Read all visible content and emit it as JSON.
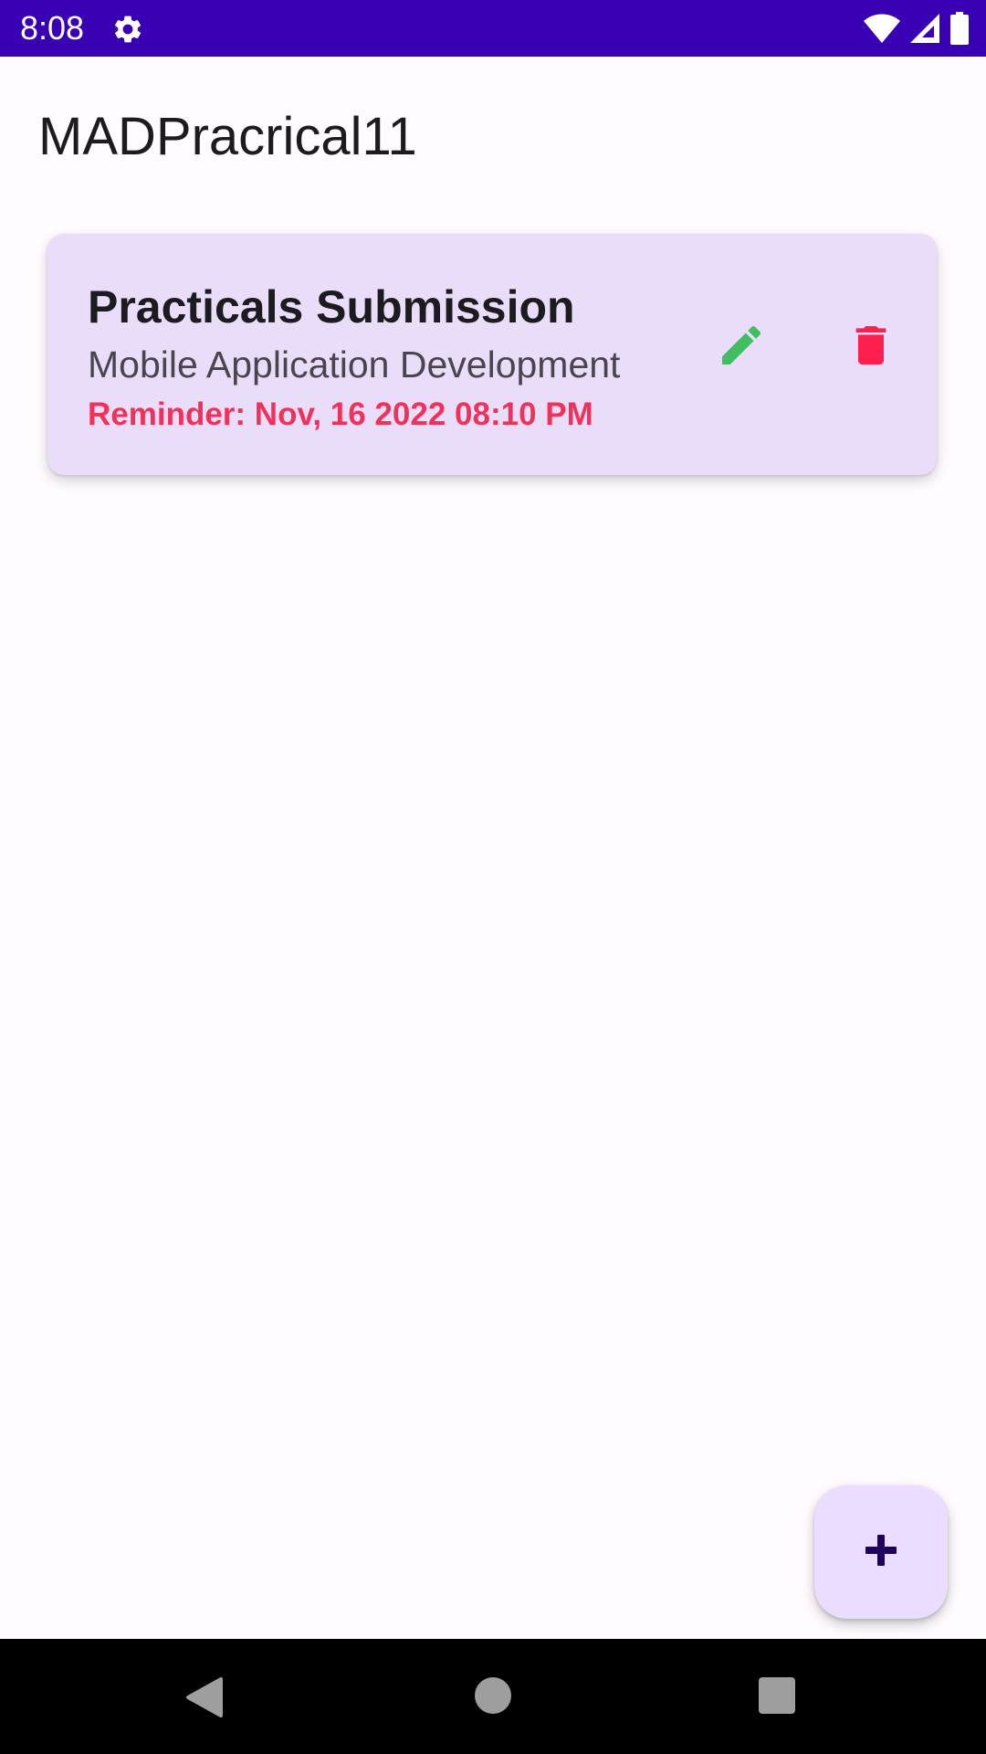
{
  "status_bar": {
    "time": "8:08",
    "background_color": "#3a00b3",
    "icons": [
      "gear-icon",
      "wifi-icon",
      "signal-icon",
      "battery-icon"
    ]
  },
  "app": {
    "title": "MADPracrical11"
  },
  "notes": [
    {
      "title": "Practicals Submission",
      "subtitle": "Mobile Application Development",
      "reminder": "Reminder: Nov, 16 2022 08:10 PM",
      "edit_icon": "pencil-icon",
      "delete_icon": "trash-icon"
    }
  ],
  "fab": {
    "icon": "plus-icon"
  },
  "colors": {
    "card_background": "#eaddfa",
    "reminder_text": "#f0325a",
    "edit_icon": "#3fbf5f",
    "delete_icon": "#ff1f4f",
    "fab_background": "#eaddff",
    "fab_icon": "#21005d"
  },
  "nav_bar": {
    "icons": [
      "back-icon",
      "home-icon",
      "recents-icon"
    ]
  }
}
